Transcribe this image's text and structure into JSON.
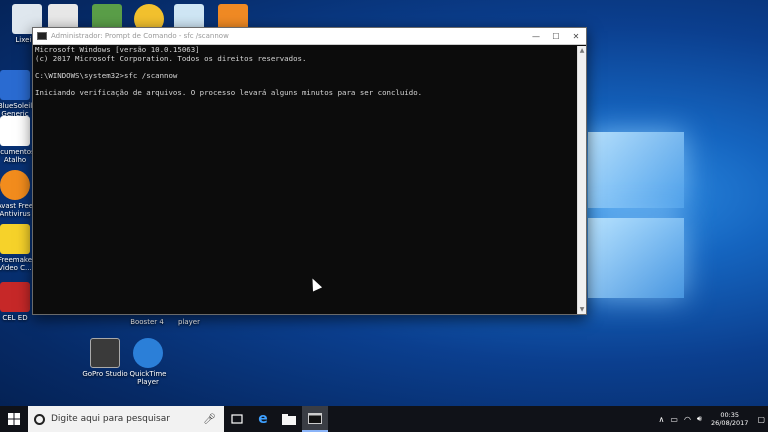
{
  "desktop": {
    "icons": [
      {
        "label": "Lixeira",
        "color": "#dfe7ee"
      },
      {
        "label": "",
        "color": "#e8e8e8"
      },
      {
        "label": "",
        "color": "#5a9e48"
      },
      {
        "label": "",
        "color": "#f2c12e"
      },
      {
        "label": "",
        "color": "#cfe6f5"
      },
      {
        "label": "",
        "color": "#f08a24"
      },
      {
        "label": "BlueSoleil Generic",
        "color": "#2a6bd1"
      },
      {
        "label": "Documentos - Atalho",
        "color": "#ffffff"
      },
      {
        "label": "Avast Free Antivirus",
        "color": "#f28c1d"
      },
      {
        "label": "Freemake Video C...",
        "color": "#f6d22a"
      },
      {
        "label": "CEL ED",
        "color": "#c62828"
      },
      {
        "label": "Booster 4",
        "color": "#2a6bd1"
      },
      {
        "label": "player",
        "color": "#444444"
      },
      {
        "label": "GoPro Studio",
        "color": "#3a3a3a"
      },
      {
        "label": "QuickTime Player",
        "color": "#2b7fd8"
      }
    ]
  },
  "console": {
    "title": "Administrador: Prompt de Comando - sfc /scannow",
    "lines": [
      "Microsoft Windows [versão 10.0.15063]",
      "(c) 2017 Microsoft Corporation. Todos os direitos reservados.",
      "",
      "C:\\WINDOWS\\system32>sfc /scannow",
      "",
      "Iniciando verificação de arquivos. O processo levará alguns minutos para ser concluído."
    ]
  },
  "taskbar": {
    "search_placeholder": "Digite aqui para pesquisar",
    "time": "00:35",
    "date": "26/08/2017"
  }
}
